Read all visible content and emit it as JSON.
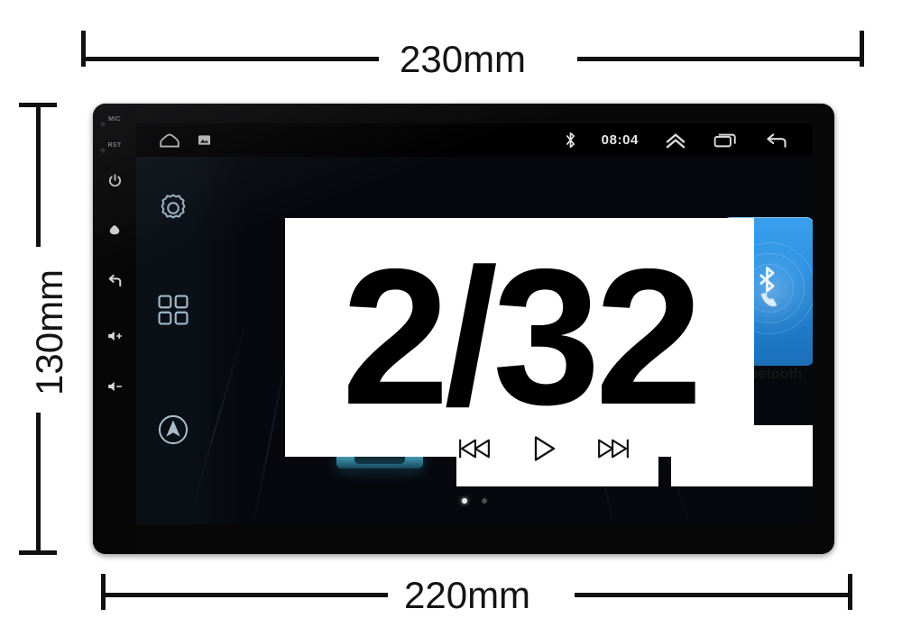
{
  "dimensions": {
    "top_label": "230mm",
    "bottom_label": "220mm",
    "left_label": "130mm"
  },
  "device": {
    "hardware_buttons": [
      {
        "name": "mic",
        "label": "MIC",
        "type": "text"
      },
      {
        "name": "reset",
        "label": "RST",
        "type": "text"
      },
      {
        "name": "power",
        "label": "power-icon",
        "type": "icon"
      },
      {
        "name": "home",
        "label": "home-icon",
        "type": "icon"
      },
      {
        "name": "back",
        "label": "back-icon",
        "type": "icon"
      },
      {
        "name": "volume-up",
        "label": "volume-up-icon",
        "type": "icon"
      },
      {
        "name": "volume-down",
        "label": "volume-down-icon",
        "type": "icon"
      }
    ]
  },
  "screen": {
    "status_bar": {
      "left_icons": [
        "home-outline-icon",
        "screenshot-icon"
      ],
      "clock": "08:04",
      "bluetooth_icon": "bluetooth-icon",
      "right_icons": [
        "chevron-up-icon",
        "recents-icon",
        "back-icon"
      ]
    },
    "dock": {
      "items": [
        {
          "name": "settings",
          "icon": "gear-icon"
        },
        {
          "name": "apps",
          "icon": "apps-grid-icon"
        },
        {
          "name": "navigation",
          "icon": "navigation-compass-icon"
        }
      ]
    },
    "bluetooth_widget": {
      "label": "Bluetooth",
      "icon": "bluetooth-phone-icon",
      "accent_color": "#2a8fe0"
    },
    "media_controls": [
      {
        "name": "previous",
        "icon": "skip-previous-icon"
      },
      {
        "name": "play",
        "icon": "play-icon"
      },
      {
        "name": "next",
        "icon": "skip-next-icon"
      }
    ],
    "page_dots": {
      "total": 2,
      "active_index": 0
    },
    "wallpaper": {
      "description": "car-rear-view-night-road",
      "top_color": "#14508c",
      "bottom_color": "#010305"
    }
  },
  "overlay": {
    "text": "2/32"
  },
  "colors": {
    "dimension_line": "#111111",
    "bezel": "#080808",
    "page_background": "#ffffff"
  }
}
